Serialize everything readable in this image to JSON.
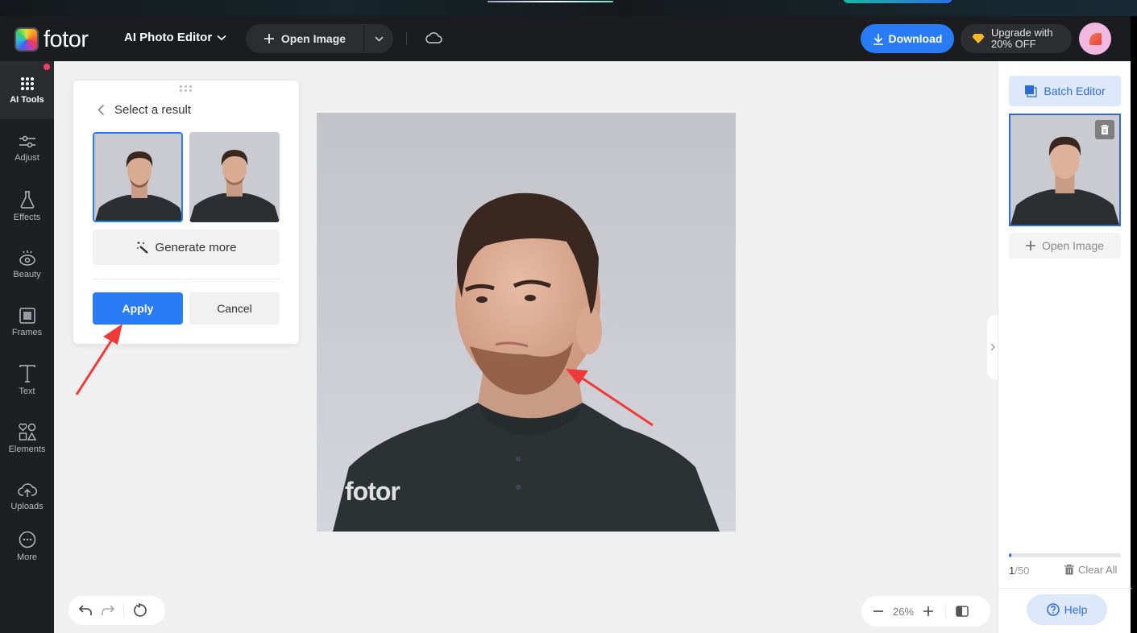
{
  "header": {
    "logo_text": "fotor",
    "editor_title": "AI Photo Editor",
    "open_image_label": "Open Image",
    "download_label": "Download",
    "upgrade_line1": "Upgrade with",
    "upgrade_line2": "20% OFF"
  },
  "sidebar": {
    "items": [
      {
        "label": "AI Tools",
        "icon": "grid-dots-icon",
        "active": true
      },
      {
        "label": "Adjust",
        "icon": "sliders-icon"
      },
      {
        "label": "Effects",
        "icon": "flask-icon"
      },
      {
        "label": "Beauty",
        "icon": "eye-icon"
      },
      {
        "label": "Frames",
        "icon": "frame-icon"
      },
      {
        "label": "Text",
        "icon": "text-icon"
      },
      {
        "label": "Elements",
        "icon": "shapes-icon"
      },
      {
        "label": "Uploads",
        "icon": "cloud-upload-icon"
      },
      {
        "label": "More",
        "icon": "more-icon"
      }
    ]
  },
  "result_panel": {
    "title": "Select a result",
    "selected_index": 0,
    "result_count": 2,
    "generate_more_label": "Generate more",
    "apply_label": "Apply",
    "cancel_label": "Cancel"
  },
  "canvas": {
    "watermark": "fotor",
    "zoom_level": "26%"
  },
  "right_panel": {
    "batch_editor_label": "Batch Editor",
    "open_image_label": "Open Image",
    "count_current": "1",
    "count_total": "/50",
    "progress_fraction": 0.02,
    "clear_all_label": "Clear All",
    "help_label": "Help"
  },
  "colors": {
    "accent": "#2a7cf6",
    "header_bg": "#1b1c1f",
    "sidebar_bg": "#1e1f23",
    "annotation_arrow": "#f03a3a"
  }
}
